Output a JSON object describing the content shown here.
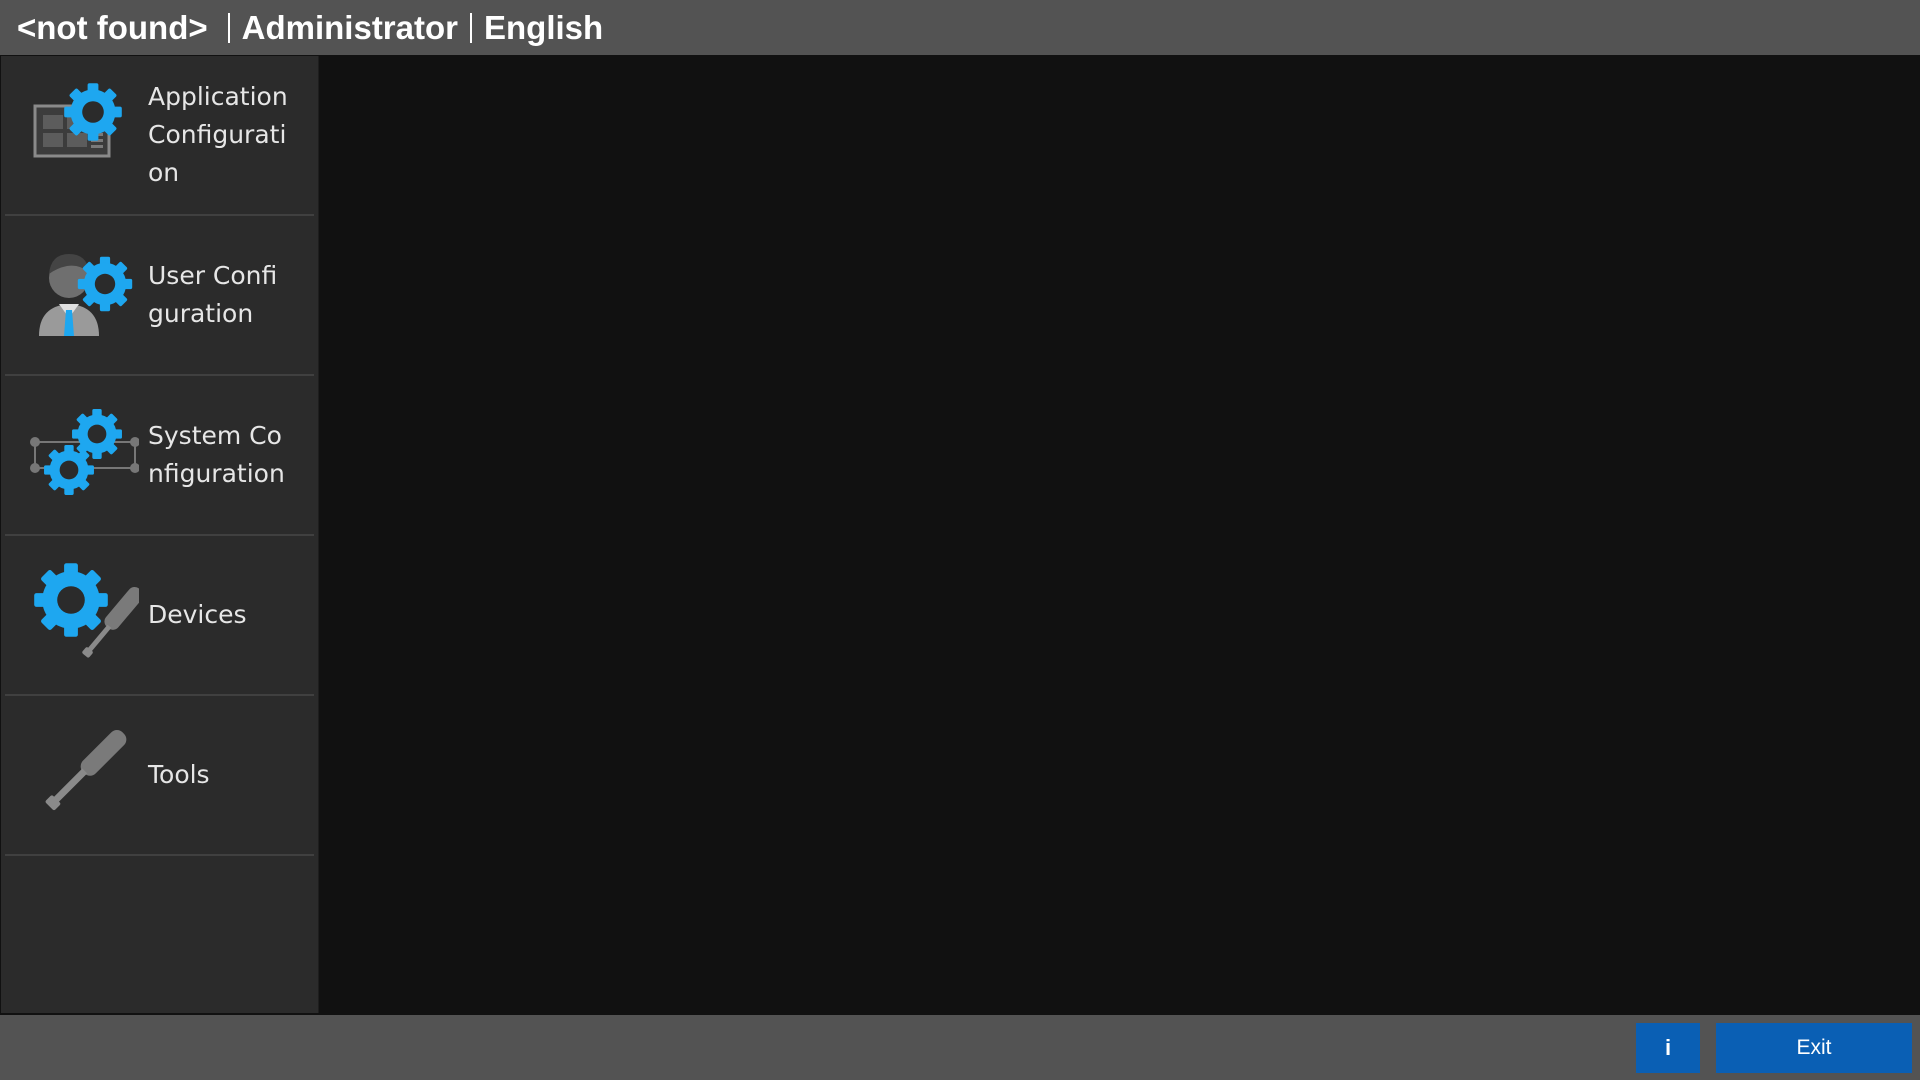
{
  "header": {
    "context": "<not found>",
    "role": "Administrator",
    "language": "English"
  },
  "sidebar": {
    "items": [
      {
        "label": "Application Configuration",
        "icon": "application-config-icon"
      },
      {
        "label": "User Configuration",
        "icon": "user-config-icon"
      },
      {
        "label": "System Configuration",
        "icon": "system-config-icon"
      },
      {
        "label": "Devices",
        "icon": "devices-icon"
      },
      {
        "label": "Tools",
        "icon": "tools-icon"
      }
    ]
  },
  "footer": {
    "info_label": "i",
    "exit_label": "Exit"
  },
  "colors": {
    "accent": "#0a5fb4",
    "gear_blue": "#1ea7f0",
    "bar_gray": "#535353",
    "sidebar_bg": "#2b2b2b",
    "content_bg": "#111111"
  }
}
